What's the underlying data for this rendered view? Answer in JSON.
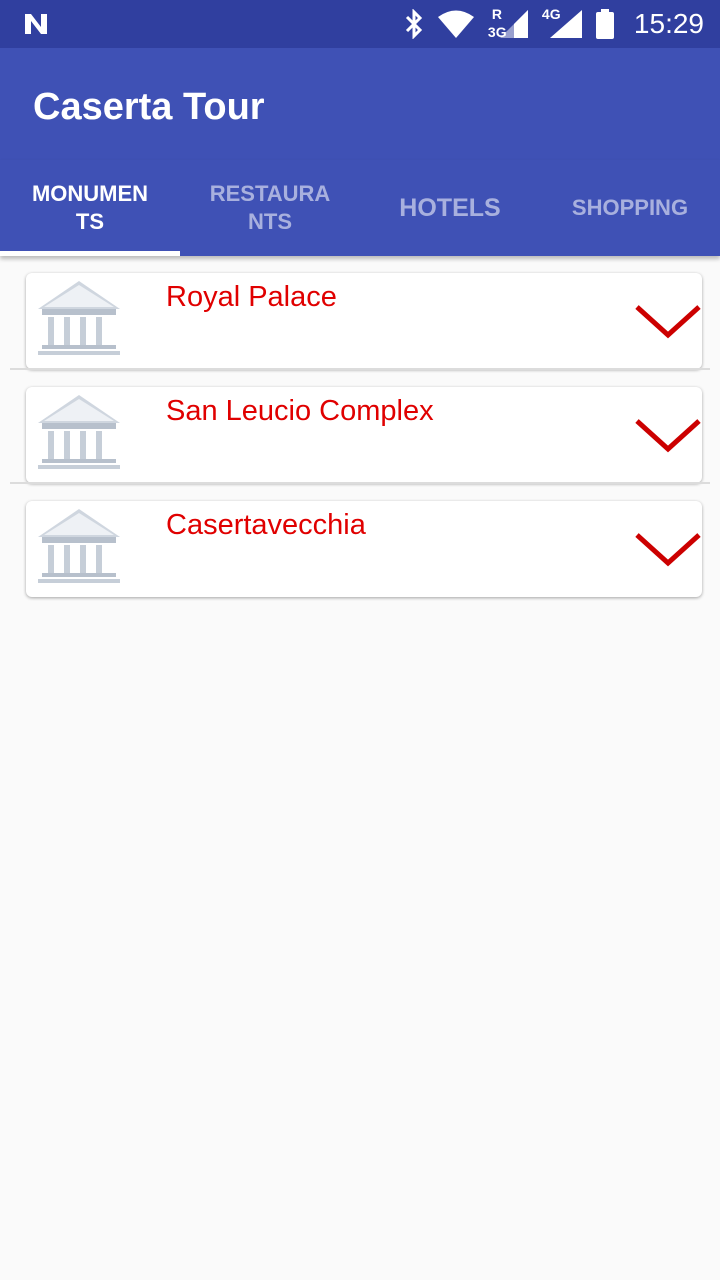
{
  "status_bar": {
    "time": "15:29",
    "icons": [
      "notification-n-icon",
      "bluetooth-icon",
      "wifi-icon",
      "signal-3g-icon",
      "signal-4g-icon",
      "battery-icon"
    ],
    "network_3g": "3G",
    "network_r": "R",
    "network_4g": "4G"
  },
  "app_bar": {
    "title": "Caserta Tour"
  },
  "tabs": [
    {
      "label": "MONUMEN\nTS",
      "active": true
    },
    {
      "label": "RESTAURA\nNTS",
      "active": false
    },
    {
      "label": "HOTELS",
      "active": false
    },
    {
      "label": "SHOPPING",
      "active": false
    }
  ],
  "monuments": [
    {
      "name": "Royal Palace",
      "icon": "monument-icon",
      "action": "chevron-down-icon"
    },
    {
      "name": "San Leucio Complex",
      "icon": "monument-icon",
      "action": "chevron-down-icon"
    },
    {
      "name": "Casertavecchia",
      "icon": "monument-icon",
      "action": "chevron-down-icon"
    }
  ],
  "colors": {
    "status_bar": "#303f9f",
    "primary": "#3f51b5",
    "title_red": "#e00000",
    "chevron_red": "#cc0000",
    "background": "#fafafa"
  }
}
